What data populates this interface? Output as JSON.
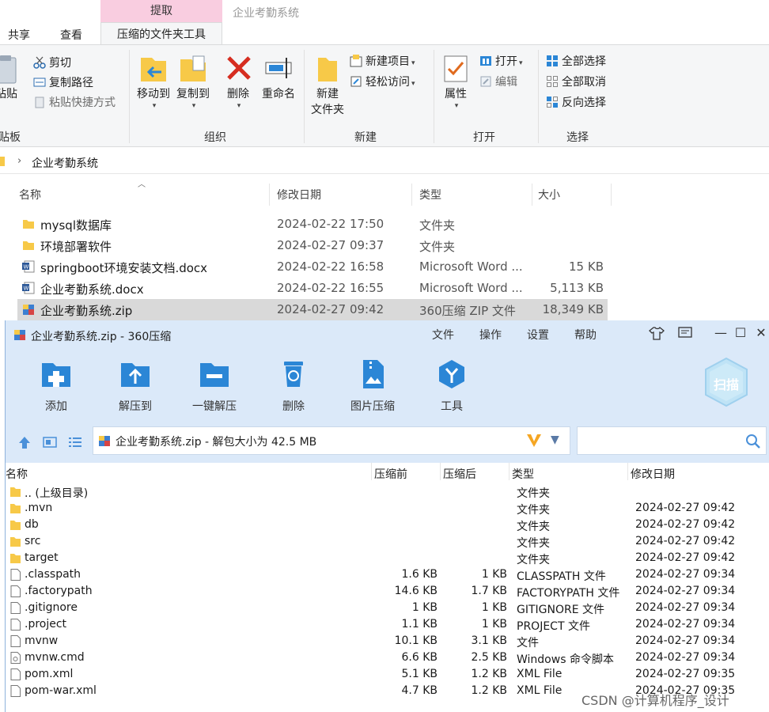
{
  "ribbon": {
    "context_header": "提取",
    "app_title": "企业考勤系统",
    "tabs": [
      "共享",
      "查看",
      "压缩的文件夹工具"
    ],
    "groups": {
      "clipboard": {
        "label": "贴板",
        "paste": "粘贴",
        "cut": "剪切",
        "copy_path": "复制路径",
        "paste_shortcut": "粘贴快捷方式"
      },
      "organize": {
        "label": "组织",
        "move_to": "移动到",
        "copy_to": "复制到",
        "delete": "删除",
        "rename": "重命名"
      },
      "new": {
        "label": "新建",
        "new_folder_1": "新建",
        "new_folder_2": "文件夹",
        "new_item": "新建项目",
        "easy_access": "轻松访问"
      },
      "open": {
        "label": "打开",
        "properties": "属性",
        "open": "打开",
        "edit": "编辑"
      },
      "select": {
        "label": "选择",
        "select_all": "全部选择",
        "select_none": "全部取消",
        "invert": "反向选择"
      }
    }
  },
  "address": {
    "crumb": "企业考勤系统"
  },
  "explorer": {
    "columns": [
      "名称",
      "修改日期",
      "类型",
      "大小"
    ],
    "rows": [
      {
        "name": "mysql数据库",
        "date": "2024-02-22 17:50",
        "type": "文件夹",
        "size": "",
        "icon": "folder-icon"
      },
      {
        "name": "环境部署软件",
        "date": "2024-02-27 09:37",
        "type": "文件夹",
        "size": "",
        "icon": "folder-icon"
      },
      {
        "name": "springboot环境安装文档.docx",
        "date": "2024-02-22 16:58",
        "type": "Microsoft Word ...",
        "size": "15 KB",
        "icon": "word-icon"
      },
      {
        "name": "企业考勤系统.docx",
        "date": "2024-02-22 16:55",
        "type": "Microsoft Word ...",
        "size": "5,113 KB",
        "icon": "word-icon"
      },
      {
        "name": "企业考勤系统.zip",
        "date": "2024-02-27 09:42",
        "type": "360压缩 ZIP 文件",
        "size": "18,349 KB",
        "icon": "zip-icon"
      }
    ]
  },
  "zip": {
    "title": "企业考勤系统.zip - 360压缩",
    "menu": [
      "文件",
      "操作",
      "设置",
      "帮助"
    ],
    "toolbar": [
      "添加",
      "解压到",
      "一键解压",
      "删除",
      "图片压缩",
      "工具"
    ],
    "scan_label": "扫描",
    "address": "企业考勤系统.zip - 解包大小为 42.5 MB",
    "columns": [
      "名称",
      "压缩前",
      "压缩后",
      "类型",
      "修改日期"
    ],
    "rows": [
      {
        "name": ".. (上级目录)",
        "before": "",
        "after": "",
        "type": "文件夹",
        "date": "",
        "icon": "folder-icon"
      },
      {
        "name": ".mvn",
        "before": "",
        "after": "",
        "type": "文件夹",
        "date": "2024-02-27 09:42",
        "icon": "folder-icon"
      },
      {
        "name": "db",
        "before": "",
        "after": "",
        "type": "文件夹",
        "date": "2024-02-27 09:42",
        "icon": "folder-icon"
      },
      {
        "name": "src",
        "before": "",
        "after": "",
        "type": "文件夹",
        "date": "2024-02-27 09:42",
        "icon": "folder-icon"
      },
      {
        "name": "target",
        "before": "",
        "after": "",
        "type": "文件夹",
        "date": "2024-02-27 09:42",
        "icon": "folder-icon"
      },
      {
        "name": ".classpath",
        "before": "1.6 KB",
        "after": "1 KB",
        "type": "CLASSPATH 文件",
        "date": "2024-02-27 09:34",
        "icon": "file-icon"
      },
      {
        "name": ".factorypath",
        "before": "14.6 KB",
        "after": "1.7 KB",
        "type": "FACTORYPATH 文件",
        "date": "2024-02-27 09:34",
        "icon": "file-icon"
      },
      {
        "name": ".gitignore",
        "before": "1 KB",
        "after": "1 KB",
        "type": "GITIGNORE 文件",
        "date": "2024-02-27 09:34",
        "icon": "file-icon"
      },
      {
        "name": ".project",
        "before": "1.1 KB",
        "after": "1 KB",
        "type": "PROJECT 文件",
        "date": "2024-02-27 09:34",
        "icon": "file-icon"
      },
      {
        "name": "mvnw",
        "before": "10.1 KB",
        "after": "3.1 KB",
        "type": "文件",
        "date": "2024-02-27 09:34",
        "icon": "file-icon"
      },
      {
        "name": "mvnw.cmd",
        "before": "6.6 KB",
        "after": "2.5 KB",
        "type": "Windows 命令脚本",
        "date": "2024-02-27 09:34",
        "icon": "cmd-icon"
      },
      {
        "name": "pom.xml",
        "before": "5.1 KB",
        "after": "1.2 KB",
        "type": "XML File",
        "date": "2024-02-27 09:35",
        "icon": "file-icon"
      },
      {
        "name": "pom-war.xml",
        "before": "4.7 KB",
        "after": "1.2 KB",
        "type": "XML File",
        "date": "2024-02-27 09:35",
        "icon": "file-icon"
      }
    ]
  },
  "watermark": "CSDN @计算机程序_设计",
  "colors": {
    "selection": "#d9d9d9",
    "zip_chrome": "#dbe9f9",
    "context_tab": "#f9cde0",
    "folder": "#f7c948",
    "accent_blue": "#2b86d6"
  }
}
